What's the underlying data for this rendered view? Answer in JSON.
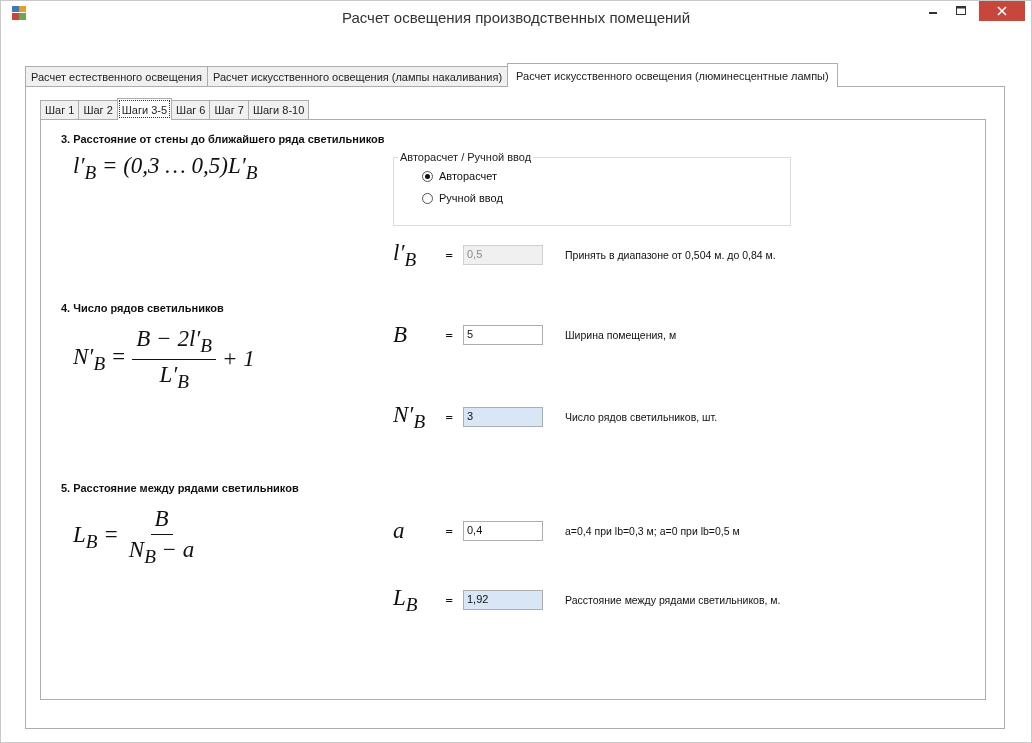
{
  "window": {
    "title": "Расчет освещения производственных помещений"
  },
  "tabs": [
    {
      "label": "Расчет естественного освещения",
      "selected": false
    },
    {
      "label": "Расчет искусственного освещения (лампы накаливания)",
      "selected": false
    },
    {
      "label": "Расчет искусственного освещения (люминесцентные лампы)",
      "selected": true
    }
  ],
  "step_tabs": [
    {
      "label": "Шаг 1",
      "selected": false
    },
    {
      "label": "Шаг 2",
      "selected": false
    },
    {
      "label": "Шаги 3-5",
      "selected": true
    },
    {
      "label": "Шаг 6",
      "selected": false
    },
    {
      "label": "Шаг 7",
      "selected": false
    },
    {
      "label": "Шаги 8-10",
      "selected": false
    }
  ],
  "sections": [
    {
      "heading": "3. Расстояние от стены до ближайшего ряда светильников",
      "formula": {
        "kind": "inline",
        "text": "l′$_{B}$ = (0,3 … 0,5)L′$_{B}$"
      },
      "mode_group": {
        "title": "Авторасчет / Ручной ввод",
        "options": [
          {
            "label": "Авторасчет",
            "selected": true
          },
          {
            "label": "Ручной ввод",
            "selected": false
          }
        ]
      },
      "rows": [
        {
          "symbol": "l′$_{B}$",
          "equals": "=",
          "value": "0,5",
          "kind": "disabled",
          "note": "Принять в диапазоне от 0,504 м. до 0,84 м."
        }
      ]
    },
    {
      "heading": "4. Число рядов светильников",
      "formula": {
        "kind": "fraction",
        "lhs": "N′$_{B}$ =",
        "numerator": "B − 2l′$_{B}$",
        "denominator": "L′$_{B}$",
        "tail": "+ 1"
      },
      "rows": [
        {
          "symbol": "B",
          "equals": "=",
          "value": "5",
          "kind": "input",
          "note": "Ширина помещения, м"
        },
        {
          "symbol": "N′$_{B}$",
          "equals": "=",
          "value": "3",
          "kind": "result",
          "note": "Число рядов светильников, шт."
        }
      ]
    },
    {
      "heading": "5. Расстояние между рядами светильников",
      "formula": {
        "kind": "fraction",
        "lhs": "L$_{B}$ =",
        "numerator": "B",
        "denominator": "N$_{B}$ − a"
      },
      "rows": [
        {
          "symbol": "a",
          "equals": "=",
          "value": "0,4",
          "kind": "input",
          "note": "a=0,4 при lb=0,3 м; a=0 при lb=0,5 м"
        },
        {
          "symbol": "L$_{B}$",
          "equals": "=",
          "value": "1,92",
          "kind": "result",
          "note": "Расстояние между рядами светильников, м."
        }
      ]
    }
  ]
}
